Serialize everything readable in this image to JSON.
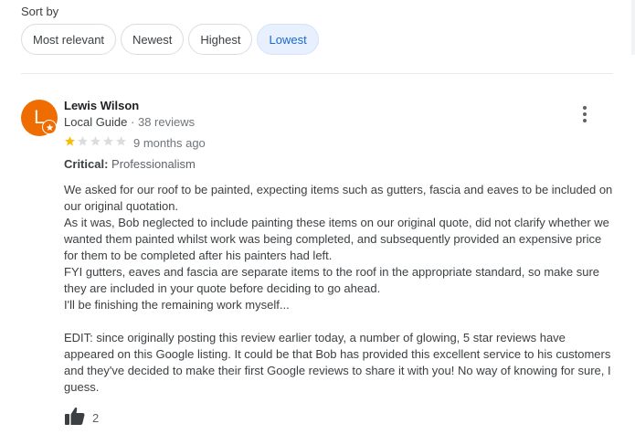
{
  "sort": {
    "label": "Sort by",
    "options": [
      "Most relevant",
      "Newest",
      "Highest",
      "Lowest"
    ],
    "selected": "Lowest"
  },
  "review": {
    "avatar_letter": "L",
    "avatar_color": "#ef6c00",
    "author": "Lewis Wilson",
    "guide_label": "Local Guide",
    "review_count": "38 reviews",
    "rating": 1,
    "rating_max": 5,
    "time": "9 months ago",
    "critical_label": "Critical:",
    "critical_value": "Professionalism",
    "text": "We asked for our roof to be painted, expecting items such as gutters, fascia and eaves to be included on our original quotation.\nAs it was, Bob neglected to include painting these items on our original quote, did not clarify whether we wanted them painted whilst work was being completed, and subsequently provided an expensive price for them to be completed after his painters had left.\nFYI gutters, eaves and fascia are separate items to the roof in the appropriate standard, so make sure they are included in your quote before deciding to go ahead.\nI'll be finishing the remaining work myself...\n\nEDIT: since originally posting this review earlier today, a number of glowing, 5 star reviews have appeared on this Google listing. It could be that Bob has provided this excellent service to his customers and they've decided to make their first Google reviews to share it with you! No way of knowing for sure, I guess.",
    "likes": "2"
  },
  "icons": {
    "badge": "local-guide-star-icon",
    "menu": "more-vert-icon",
    "like": "thumb-up-icon"
  },
  "colors": {
    "star_filled": "#fbbc04",
    "star_empty": "#dadce0",
    "chip_selected_bg": "#e8f0fe",
    "chip_selected_text": "#1967d2"
  }
}
